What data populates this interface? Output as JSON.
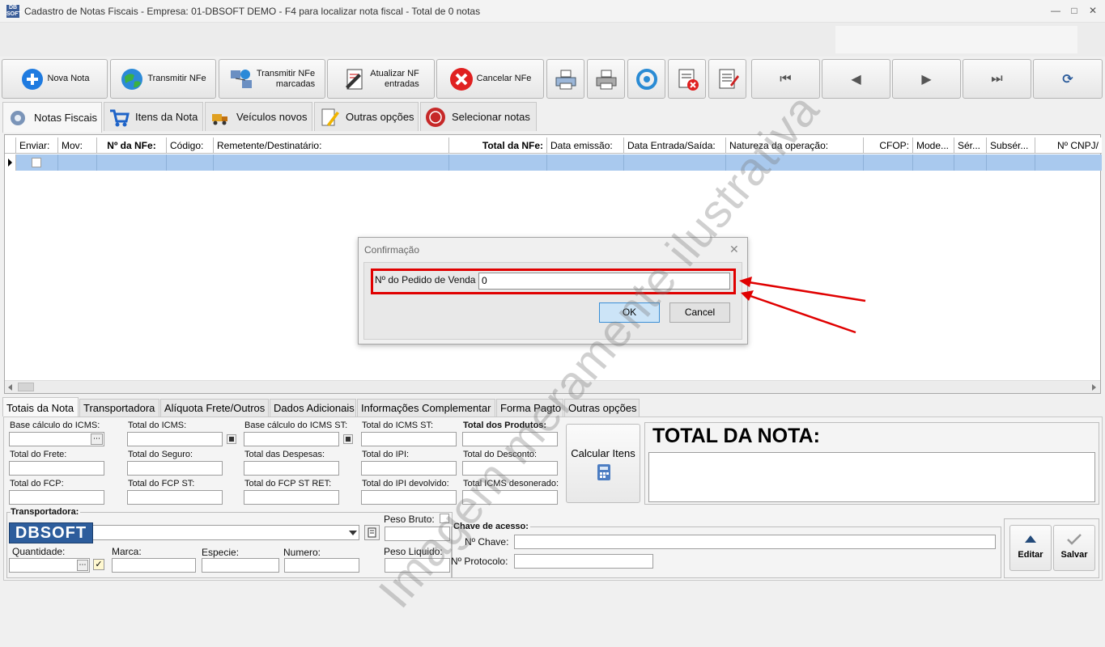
{
  "titlebar": {
    "icon_text": "DB SOFT",
    "title": "Cadastro de Notas Fiscais - Empresa: 01-DBSOFT DEMO - F4 para localizar nota fiscal - Total de 0 notas"
  },
  "toolbar": {
    "nova_nota": "Nova Nota",
    "transmitir_nfe": "Transmitir NFe",
    "transmitir_marcadas_1": "Transmitir NFe",
    "transmitir_marcadas_2": "marcadas",
    "atualizar_1": "Atualizar NF",
    "atualizar_2": "entradas",
    "cancelar_nfe": "Cancelar NFe"
  },
  "nav": {
    "first": "⏮",
    "prev": "◀",
    "next": "▶",
    "last": "⏭",
    "refresh": "⟳"
  },
  "tabs": {
    "notas_fiscais": "Notas Fiscais",
    "itens_nota": "Itens da Nota",
    "veiculos": "Veículos novos",
    "outras": "Outras opções",
    "selecionar": "Selecionar notas"
  },
  "grid": {
    "columns": [
      "Enviar:",
      "Mov:",
      "Nº da NFe:",
      "Código:",
      "Remetente/Destinatário:",
      "Total da NFe:",
      "Data emissão:",
      "Data Entrada/Saída:",
      "Natureza da operação:",
      "CFOP:",
      "Mode...",
      "Sér...",
      "Subsér...",
      "Nº CNPJ/"
    ]
  },
  "dialog": {
    "title": "Confirmação",
    "field_label": "Nº do Pedido de Venda",
    "field_value": "0",
    "ok": "OK",
    "cancel": "Cancel"
  },
  "bottom_tabs": [
    "Totais da Nota",
    "Transportadora",
    "Alíquota Frete/Outros",
    "Dados Adicionais",
    "Informações Complementar",
    "Forma Pagto",
    "Outras opções"
  ],
  "totais": {
    "base_icms": "Base cálculo do ICMS:",
    "total_icms": "Total do ICMS:",
    "base_icms_st": "Base cálculo do ICMS ST:",
    "total_icms_st": "Total do ICMS ST:",
    "total_produtos": "Total dos Produtos:",
    "total_frete": "Total do Frete:",
    "total_seguro": "Total do Seguro:",
    "total_despesas": "Total das Despesas:",
    "total_ipi": "Total do IPI:",
    "total_desconto": "Total do Desconto:",
    "total_fcp": "Total do FCP:",
    "total_fcp_st": "Total do FCP ST:",
    "total_fcp_st_ret": "Total do FCP ST RET:",
    "total_ipi_devolvido": "Total do IPI devolvido:",
    "total_icms_desonerado": "Total ICMS desonerado:",
    "calcular_itens": "Calcular Itens",
    "total_da_nota": "TOTAL DA NOTA:"
  },
  "transporte": {
    "transportadora": "Transportadora:",
    "peso_bruto": "Peso Bruto:",
    "quantidade": "Quantidade:",
    "marca": "Marca:",
    "especie": "Especie:",
    "numero": "Numero:",
    "peso_liquido": "Peso Liquido:",
    "chave_acesso": "Chave de acesso:",
    "n_chave": "Nº Chave:",
    "n_protocolo": "Nº Protocolo:",
    "editar": "Editar",
    "salvar": "Salvar",
    "logo": "DBSOFT"
  },
  "watermark": "Imagem meramente ilustrativa"
}
